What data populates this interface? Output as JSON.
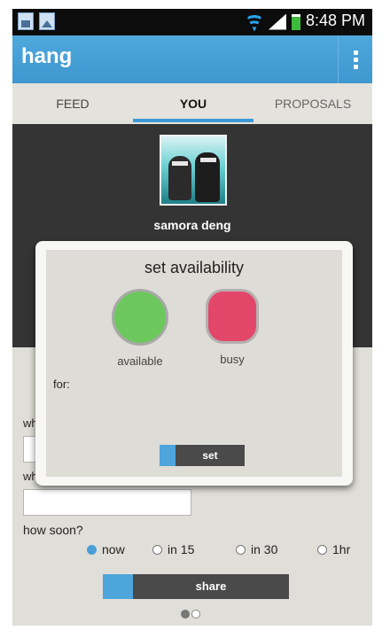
{
  "status_bar": {
    "time": "8:48 PM",
    "icons": [
      "sim-icon",
      "gallery-icon",
      "wifi-icon",
      "signal-icon",
      "battery-icon"
    ]
  },
  "app_bar": {
    "title": "hang",
    "overflow_icon": "more-vert-icon"
  },
  "tabs": [
    {
      "label": "FEED",
      "active": false
    },
    {
      "label": "YOU",
      "active": true
    },
    {
      "label": "PROPOSALS",
      "active": false
    }
  ],
  "profile": {
    "name": "samora deng"
  },
  "form": {
    "field1_label_partial": "wh",
    "field2_label_partial": "wh",
    "how_soon_label": "how soon?",
    "options": [
      {
        "label": "now",
        "selected": true
      },
      {
        "label": "in 15",
        "selected": false
      },
      {
        "label": "in 30",
        "selected": false
      },
      {
        "label": "1hr",
        "selected": false
      }
    ],
    "share_label": "share",
    "pager": {
      "pages": 2,
      "current": 1
    }
  },
  "dialog": {
    "title": "set availability",
    "available_label": "available",
    "busy_label": "busy",
    "for_label": "for:",
    "set_label": "set"
  },
  "colors": {
    "accent": "#3e9ad4",
    "available": "#6cc85c",
    "busy": "#e2476a",
    "dark": "#343434"
  }
}
